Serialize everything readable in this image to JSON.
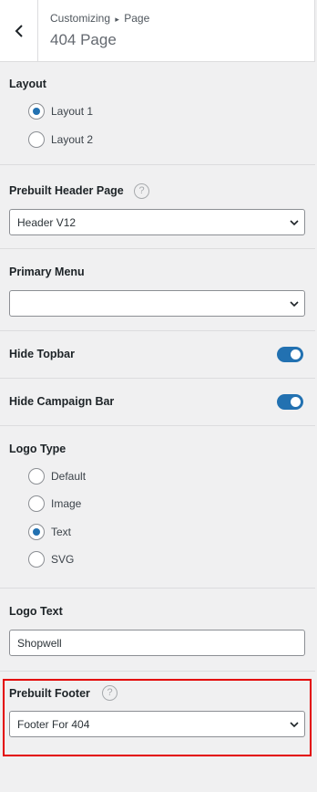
{
  "header": {
    "breadcrumb_prefix": "Customizing",
    "breadcrumb_sep": "▸",
    "breadcrumb_page": "Page",
    "title": "404 Page"
  },
  "layout": {
    "label": "Layout",
    "options": [
      "Layout 1",
      "Layout 2"
    ],
    "selected": "Layout 1"
  },
  "prebuilt_header": {
    "label": "Prebuilt Header Page",
    "value": "Header V12"
  },
  "primary_menu": {
    "label": "Primary Menu",
    "value": ""
  },
  "hide_topbar": {
    "label": "Hide Topbar",
    "on": true
  },
  "hide_campaign": {
    "label": "Hide Campaign Bar",
    "on": true
  },
  "logo_type": {
    "label": "Logo Type",
    "options": [
      "Default",
      "Image",
      "Text",
      "SVG"
    ],
    "selected": "Text"
  },
  "logo_text": {
    "label": "Logo Text",
    "value": "Shopwell"
  },
  "prebuilt_footer": {
    "label": "Prebuilt Footer",
    "value": "Footer For 404"
  },
  "icons": {
    "help": "?",
    "accent": "#2271b1",
    "highlight": "#e30000"
  }
}
